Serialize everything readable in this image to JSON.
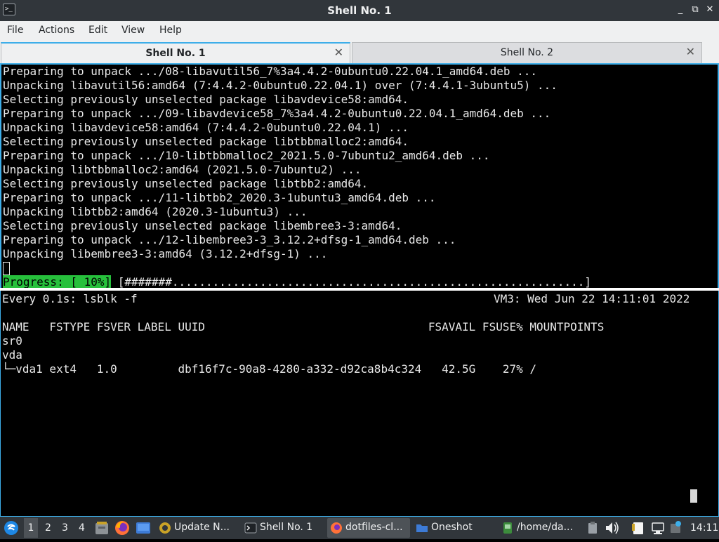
{
  "window": {
    "title": "Shell No. 1",
    "buttons": {
      "minimize": "_",
      "restore": "⧉",
      "close": "✕"
    }
  },
  "menu": [
    "File",
    "Actions",
    "Edit",
    "View",
    "Help"
  ],
  "tabs": [
    {
      "label": "Shell No. 1",
      "active": true
    },
    {
      "label": "Shell No. 2",
      "active": false
    }
  ],
  "top_pane": {
    "lines": [
      "Preparing to unpack .../08-libavutil56_7%3a4.4.2-0ubuntu0.22.04.1_amd64.deb ...",
      "Unpacking libavutil56:amd64 (7:4.4.2-0ubuntu0.22.04.1) over (7:4.4.1-3ubuntu5) ...",
      "Selecting previously unselected package libavdevice58:amd64.",
      "Preparing to unpack .../09-libavdevice58_7%3a4.4.2-0ubuntu0.22.04.1_amd64.deb ...",
      "Unpacking libavdevice58:amd64 (7:4.4.2-0ubuntu0.22.04.1) ...",
      "Selecting previously unselected package libtbbmalloc2:amd64.",
      "Preparing to unpack .../10-libtbbmalloc2_2021.5.0-7ubuntu2_amd64.deb ...",
      "Unpacking libtbbmalloc2:amd64 (2021.5.0-7ubuntu2) ...",
      "Selecting previously unselected package libtbb2:amd64.",
      "Preparing to unpack .../11-libtbb2_2020.3-1ubuntu3_amd64.deb ...",
      "Unpacking libtbb2:amd64 (2020.3-1ubuntu3) ...",
      "Selecting previously unselected package libembree3-3:amd64.",
      "Preparing to unpack .../12-libembree3-3_3.12.2+dfsg-1_amd64.deb ...",
      "Unpacking libembree3-3:amd64 (3.12.2+dfsg-1) ..."
    ],
    "progress_label": "Progress: [ 10%]",
    "progress_bar": " [#######.............................................................]",
    "progress_percent": 10
  },
  "bottom_pane": {
    "watch_header": "Every 0.1s: lsblk -f",
    "watch_status": "VM3: Wed Jun 22 14:11:01 2022",
    "lines": [
      "NAME   FSTYPE FSVER LABEL UUID                                 FSAVAIL FSUSE% MOUNTPOINTS",
      "sr0",
      "vda",
      "└─vda1 ext4   1.0         dbf16f7c-90a8-4280-a332-d92ca8b4c324   42.5G    27% /"
    ]
  },
  "taskbar": {
    "desktops": [
      "1",
      "2",
      "3",
      "4"
    ],
    "active_desktop": "1",
    "tasks": [
      {
        "label": "Update N...",
        "icon": "update-notifier-icon",
        "active": false
      },
      {
        "label": "Shell No. 1",
        "icon": "terminal-icon",
        "active": false
      },
      {
        "label": "dotfiles-cl...",
        "icon": "firefox-icon",
        "active": true
      },
      {
        "label": "Oneshot",
        "icon": "folder-icon",
        "active": false
      },
      {
        "label": "/home/da...",
        "icon": "terminal-green-icon",
        "active": false
      }
    ],
    "clock": "14:11"
  }
}
